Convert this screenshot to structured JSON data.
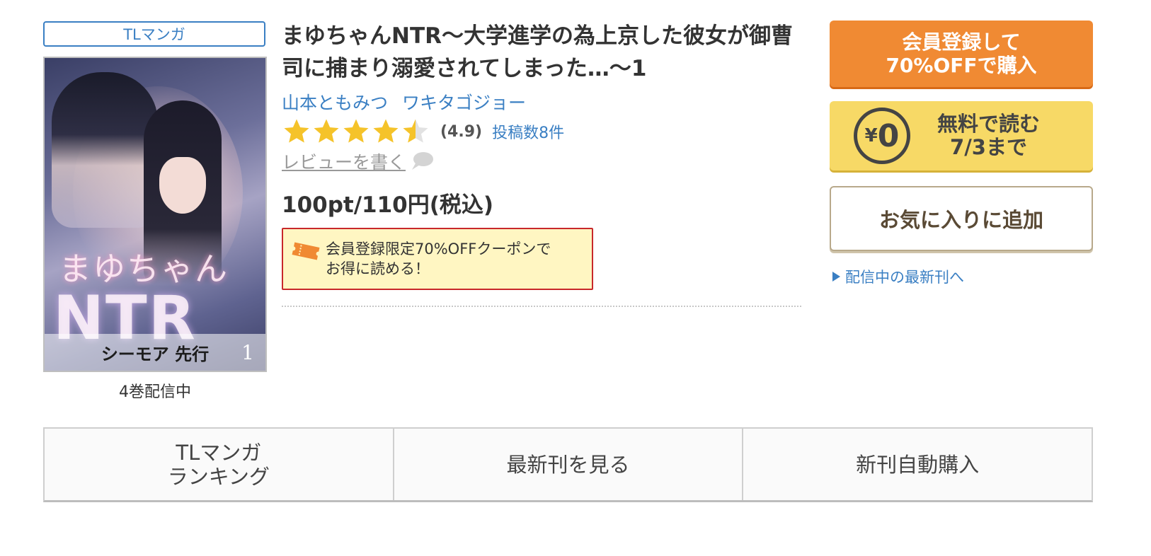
{
  "product": {
    "genre": "TLマンガ",
    "title": "まゆちゃんNTR〜大学進学の為上京した彼女が御曹司に捕まり溺愛されてしまった…〜1",
    "authors": [
      "山本ともみつ",
      "ワキタゴジョー"
    ],
    "rating": {
      "value": 4.9,
      "max": 5,
      "display": "(4.9)",
      "review_count_label": "投稿数8件"
    },
    "write_review_label": "レビューを書く",
    "price": "100pt/110円(税込)",
    "volumes_label": "4巻配信中",
    "cover": {
      "art_title": "まゆちゃん",
      "art_ntr": "NTR",
      "volume_number": "1",
      "brand": "シーモア 先行"
    }
  },
  "coupon": {
    "text_line1": "会員登録限定70%OFFクーポンで",
    "text_line2": "お得に読める！"
  },
  "actions": {
    "register_line1": "会員登録して",
    "register_line2": "70%OFFで購入",
    "free_yen": "¥",
    "free_zero": "0",
    "free_line1": "無料で読む",
    "free_line2": "7/3まで",
    "favorite": "お気に入りに追加",
    "latest_link": "配信中の最新刊へ"
  },
  "tabs": {
    "ranking_line1": "TLマンガ",
    "ranking_line2": "ランキング",
    "latest": "最新刊を見る",
    "auto_buy": "新刊自動購入"
  },
  "colors": {
    "link_blue": "#3a7fc3",
    "register_orange": "#f08a33",
    "free_yellow": "#f7d966",
    "coupon_bg": "#fff6c2",
    "coupon_border": "#c8282a",
    "star_gold": "#f5c32a"
  }
}
